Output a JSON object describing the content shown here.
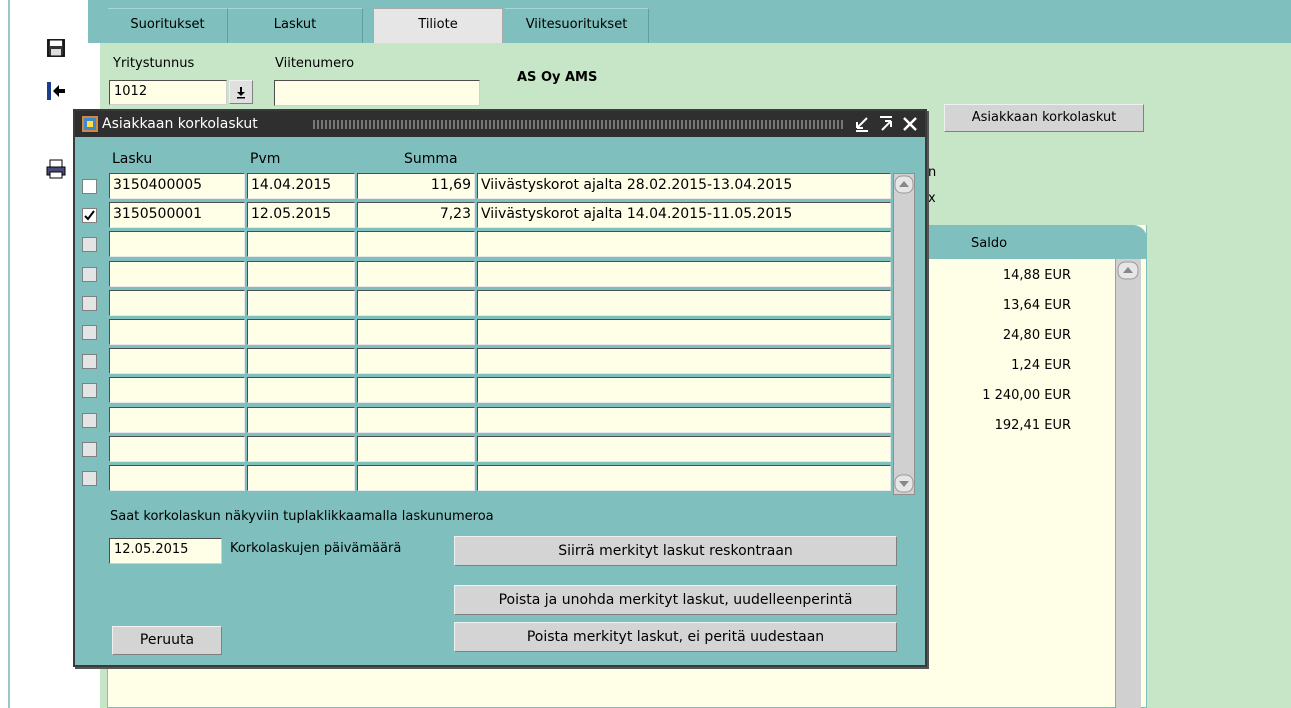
{
  "tabs": [
    {
      "label": "Suoritukset"
    },
    {
      "label": "Laskut"
    },
    {
      "label": "Tiliote"
    },
    {
      "label": "Viitesuoritukset"
    }
  ],
  "form": {
    "yritystunnus_label": "Yritystunnus",
    "yritystunnus_value": "1012",
    "viitenumero_label": "Viitenumero",
    "viitenumero_value": "",
    "company_name": "AS Oy AMS"
  },
  "right_button": "Asiakkaan korkolaskut",
  "background_grid": {
    "partial_labels": [
      "n",
      "x"
    ],
    "saldo_header": "Saldo",
    "saldo_values": [
      "14,88 EUR",
      "13,64 EUR",
      "24,80 EUR",
      "1,24 EUR",
      "1 240,00 EUR",
      "192,41 EUR"
    ]
  },
  "modal": {
    "title": "Asiakkaan korkolaskut",
    "columns": {
      "lasku": "Lasku",
      "pvm": "Pvm",
      "summa": "Summa"
    },
    "rows": [
      {
        "checked": false,
        "lasku": "3150400005",
        "pvm": "14.04.2015",
        "summa": "11,69",
        "desc": "Viivästyskorot ajalta 28.02.2015-13.04.2015"
      },
      {
        "checked": true,
        "lasku": "3150500001",
        "pvm": "12.05.2015",
        "summa": "7,23",
        "desc": "Viivästyskorot ajalta 14.04.2015-11.05.2015"
      },
      {
        "checked": false,
        "lasku": "",
        "pvm": "",
        "summa": "",
        "desc": ""
      },
      {
        "checked": false,
        "lasku": "",
        "pvm": "",
        "summa": "",
        "desc": ""
      },
      {
        "checked": false,
        "lasku": "",
        "pvm": "",
        "summa": "",
        "desc": ""
      },
      {
        "checked": false,
        "lasku": "",
        "pvm": "",
        "summa": "",
        "desc": ""
      },
      {
        "checked": false,
        "lasku": "",
        "pvm": "",
        "summa": "",
        "desc": ""
      },
      {
        "checked": false,
        "lasku": "",
        "pvm": "",
        "summa": "",
        "desc": ""
      },
      {
        "checked": false,
        "lasku": "",
        "pvm": "",
        "summa": "",
        "desc": ""
      },
      {
        "checked": false,
        "lasku": "",
        "pvm": "",
        "summa": "",
        "desc": ""
      },
      {
        "checked": false,
        "lasku": "",
        "pvm": "",
        "summa": "",
        "desc": ""
      }
    ],
    "hint": "Saat korkolaskun näkyviin tuplaklikkaamalla laskunumeroa",
    "date_value": "12.05.2015",
    "date_label": "Korkolaskujen päivämäärä",
    "btn_siirra": "Siirrä merkityt laskut reskontraan",
    "btn_poista_unohda": "Poista ja unohda merkityt laskut, uudelleenperintä",
    "btn_poista": "Poista merkityt laskut, ei peritä uudestaan",
    "btn_peruuta": "Peruuta"
  },
  "icons": [
    "save-icon",
    "exit-icon",
    "print-icon",
    "minimize-icon",
    "maximize-icon",
    "close-icon",
    "app-icon"
  ]
}
